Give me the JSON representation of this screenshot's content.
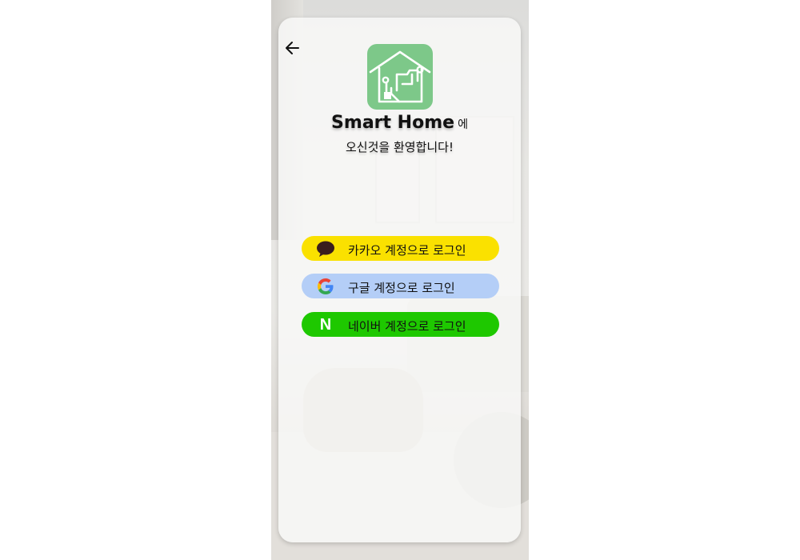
{
  "header": {
    "back_icon": "arrow-left-icon"
  },
  "logo": {
    "icon": "smart-home-house-icon",
    "color": "#7dc889"
  },
  "welcome": {
    "title": "Smart Home",
    "title_suffix": "에",
    "subtitle": "오신것을 환영합니다!"
  },
  "login": {
    "kakao": {
      "label": "카카오 계정으로 로그인",
      "icon": "kakao-speech-bubble-icon",
      "color": "#fae100"
    },
    "google": {
      "label": "구글 계정으로 로그인",
      "icon": "google-g-icon",
      "color": "#b4cef7"
    },
    "naver": {
      "label": "네이버 계정으로 로그인",
      "icon": "naver-n-icon",
      "icon_text": "N",
      "color": "#1ec800"
    }
  }
}
